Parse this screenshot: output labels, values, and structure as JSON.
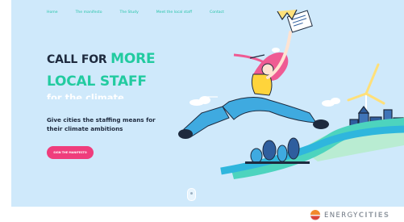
{
  "nav": {
    "items": [
      "Home",
      "The manifesto",
      "The Study",
      "Meet the local staff",
      "Contact"
    ]
  },
  "hero": {
    "title_part1": "CALL FOR ",
    "title_accent": "MORE",
    "title_line2": "LOCAL STAFF",
    "title_line3": "for the climate",
    "subtitle": "Give cities the staffing means for their climate ambitions",
    "cta_label": "SIGN THE MANIFESTO"
  },
  "footer": {
    "logo_text_part1": "ENERGY",
    "logo_text_part2": "CITIES"
  },
  "colors": {
    "background": "#cfe9fb",
    "accent": "#22cba0",
    "dark": "#1e2a3e",
    "cta": "#ef3d7c"
  }
}
